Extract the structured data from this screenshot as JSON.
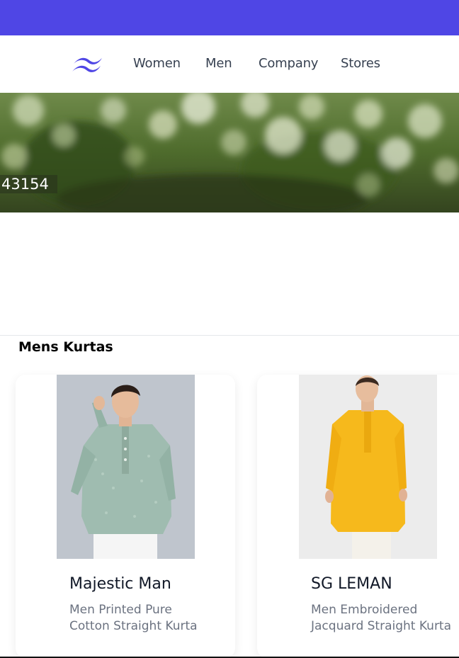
{
  "theme": {
    "accent": "#4f46e5",
    "nav_text": "#374151",
    "desc_text": "#6b7280"
  },
  "header": {
    "logo_icon": "tailwind-wave-logo",
    "nav": [
      {
        "label": "Women"
      },
      {
        "label": "Men"
      },
      {
        "label": "Company"
      },
      {
        "label": "Stores"
      }
    ]
  },
  "hero": {
    "image": "bokeh-green-foliage",
    "badge": "43154"
  },
  "section": {
    "title": "Mens Kurtas"
  },
  "products": [
    {
      "brand": "Majestic Man",
      "description": "Men Printed Pure Cotton Straight Kurta",
      "image": "man-in-sage-green-printed-short-kurta"
    },
    {
      "brand": "SG LEMAN",
      "description": "Men Embroidered Jacquard Straight Kurta",
      "image": "man-in-mustard-yellow-long-kurta"
    }
  ]
}
